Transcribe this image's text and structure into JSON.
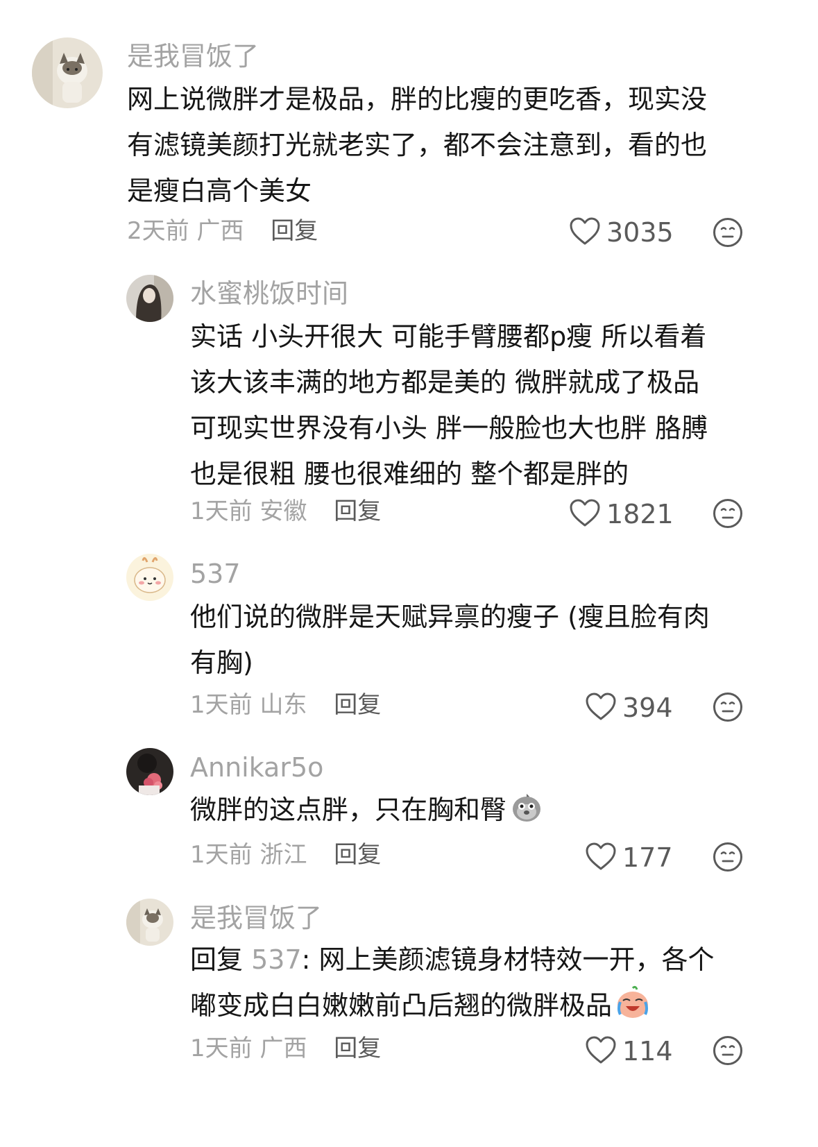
{
  "comments": [
    {
      "author": "是我冒饭了",
      "lines": [
        "网上说微胖才是极品，胖的比瘦的更吃香，现实没",
        "有滤镜美颜打光就老实了，都不会注意到，看的也",
        "是瘦白高个美女"
      ],
      "time": "2天前",
      "location": "广西",
      "reply_label": "回复",
      "likes": "3035"
    },
    {
      "author": "水蜜桃饭时间",
      "lines": [
        "实话 小头开很大 可能手臂腰都p瘦  所以看着",
        "该大该丰满的地方都是美的 微胖就成了极品",
        "可现实世界没有小头 胖一般脸也大也胖 胳膊",
        "也是很粗 腰也很难细的 整个都是胖的"
      ],
      "time": "1天前",
      "location": "安徽",
      "reply_label": "回复",
      "likes": "1821"
    },
    {
      "author": "537",
      "lines": [
        "他们说的微胖是天赋异禀的瘦子 (瘦且脸有肉",
        "有胸)"
      ],
      "time": "1天前",
      "location": "山东",
      "reply_label": "回复",
      "likes": "394"
    },
    {
      "author": "Annikar5o",
      "lines": [
        "微胖的这点胖，只在胸和臀"
      ],
      "time": "1天前",
      "location": "浙江",
      "reply_label": "回复",
      "likes": "177"
    },
    {
      "author": "是我冒饭了",
      "reply_prefix": "回复",
      "reply_target": "537",
      "reply_colon": ": ",
      "lines": [
        "网上美颜滤镜身材特效一开，各个",
        "嘟变成白白嫩嫩前凸后翘的微胖极品"
      ],
      "time": "1天前",
      "location": "广西",
      "reply_label": "回复",
      "likes": "114"
    }
  ],
  "icons": {
    "like": "heart-outline-icon",
    "dislike": "neutral-face-icon",
    "emoji_pigeon": "pigeon-emoji",
    "emoji_crying": "crying-face-emoji"
  },
  "colors": {
    "name": "#a3a3a3",
    "text": "#161616",
    "meta": "#a3a3a3",
    "reply_action": "#5a5a5a"
  }
}
